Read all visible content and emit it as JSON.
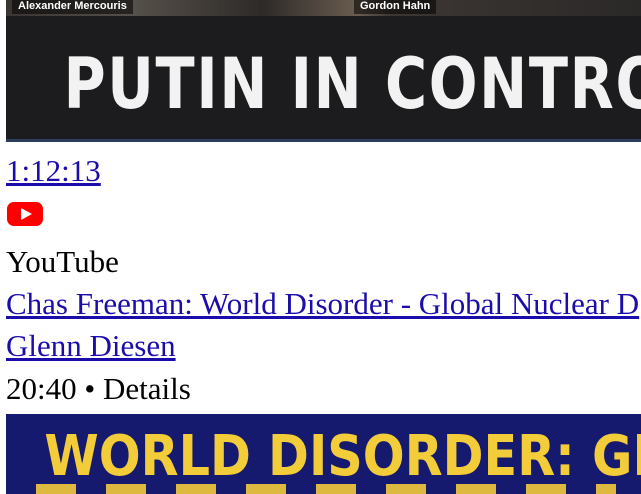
{
  "video1": {
    "thumbnail_names": [
      "Alexander Mercouris",
      "Gordon Hahn"
    ],
    "thumbnail_headline": "PUTIN IN CONTROL",
    "duration": "1:12:13",
    "source_icon": "youtube-icon",
    "source": "YouTube"
  },
  "video2": {
    "title": "Chas Freeman: World Disorder - Global Nuclear D",
    "channel": "Glenn Diesen",
    "duration": "20:40",
    "separator": "•",
    "details": "Details",
    "thumbnail_headline": "WORLD DISORDER: GLOBAL"
  },
  "colors": {
    "link": "#1a0dab",
    "youtube_red": "#ff0000",
    "thumb2_bg": "#151a6e",
    "thumb2_text": "#f3cc3a"
  }
}
